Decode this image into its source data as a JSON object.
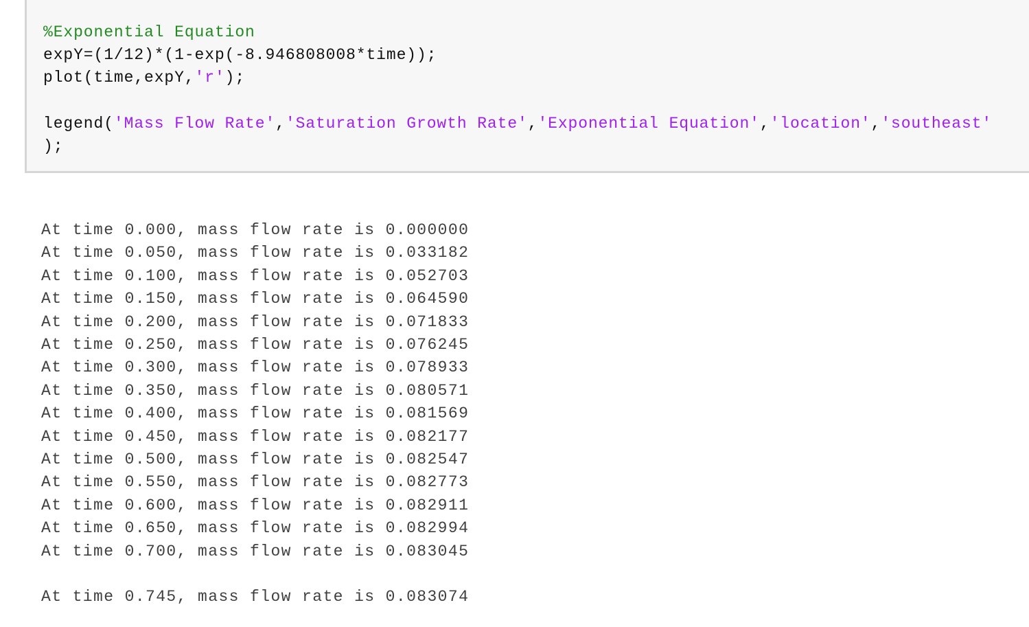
{
  "code": {
    "comment": "%Exponential Equation",
    "line_expY": "expY=(1/12)*(1-exp(-8.946808008*time));",
    "plot": {
      "prefix": "plot(time,expY,",
      "arg": "'r'",
      "suffix": ");"
    },
    "legend": {
      "prefix": "legend(",
      "args": [
        "'Mass Flow Rate'",
        "'Saturation Growth Rate'",
        "'Exponential Equation'",
        "'location'",
        "'southeast'"
      ],
      "separator": ",",
      "continuation": ");"
    }
  },
  "colors": {
    "comment": "#228b22",
    "string": "#a020f0",
    "code_text": "#111111",
    "output_text": "#404040",
    "code_background": "#f7f7f7"
  },
  "output": {
    "lines": [
      "At time 0.000, mass flow rate is 0.000000",
      "At time 0.050, mass flow rate is 0.033182",
      "At time 0.100, mass flow rate is 0.052703",
      "At time 0.150, mass flow rate is 0.064590",
      "At time 0.200, mass flow rate is 0.071833",
      "At time 0.250, mass flow rate is 0.076245",
      "At time 0.300, mass flow rate is 0.078933",
      "At time 0.350, mass flow rate is 0.080571",
      "At time 0.400, mass flow rate is 0.081569",
      "At time 0.450, mass flow rate is 0.082177",
      "At time 0.500, mass flow rate is 0.082547",
      "At time 0.550, mass flow rate is 0.082773",
      "At time 0.600, mass flow rate is 0.082911",
      "At time 0.650, mass flow rate is 0.082994",
      "At time 0.700, mass flow rate is 0.083045"
    ],
    "final_line": "At time 0.745, mass flow rate is 0.083074"
  }
}
